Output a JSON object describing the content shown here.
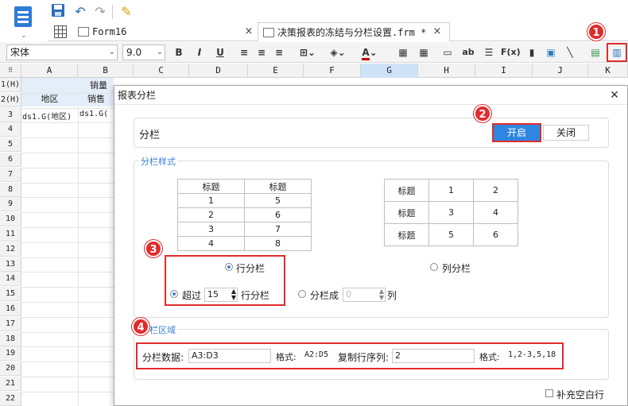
{
  "toolbar": {
    "tabs": [
      {
        "label": "Form16",
        "active": false
      },
      {
        "label": "决策报表的冻结与分栏设置.frm *",
        "active": true
      }
    ]
  },
  "format": {
    "font_name": "宋体",
    "font_size": "9.0",
    "bold": "B",
    "italic": "I",
    "underline": "U"
  },
  "sheet": {
    "columns": [
      "A",
      "B",
      "C",
      "D",
      "E",
      "F",
      "G",
      "H",
      "I",
      "J",
      "K"
    ],
    "rows": [
      "1(H)",
      "2(H)",
      "3",
      "4",
      "5",
      "6",
      "7",
      "8",
      "9",
      "10",
      "11",
      "12",
      "13",
      "14",
      "15",
      "16",
      "17",
      "18",
      "19",
      "20",
      "21",
      "22"
    ],
    "cell_c1": "销量",
    "cell_a2": "地区",
    "cell_b2": "销售",
    "cell_a3": "ds1.G(地区)",
    "cell_b3": "ds1.G("
  },
  "dialog": {
    "title": "报表分栏",
    "section_label": "分栏",
    "open_label": "开启",
    "close_label": "关闭",
    "style_group": "分栏样式",
    "left_preview": [
      [
        "标题",
        "标题"
      ],
      [
        "1",
        "5"
      ],
      [
        "2",
        "6"
      ],
      [
        "3",
        "7"
      ],
      [
        "4",
        "8"
      ]
    ],
    "right_preview": [
      [
        "标题",
        "1",
        "2"
      ],
      [
        "标题",
        "3",
        "4"
      ],
      [
        "标题",
        "5",
        "6"
      ]
    ],
    "row_mode_label": "行分栏",
    "col_mode_label": "列分栏",
    "exceed_label": "超过",
    "exceed_value": "15",
    "exceed_suffix": "行分栏",
    "split_into_label": "分栏成",
    "split_into_value": "0",
    "split_into_suffix": "列",
    "area_group": "分栏区域",
    "data_label": "分栏数据:",
    "data_value": "A3:D3",
    "format1_label": "格式:",
    "format1_value": "A2:D5",
    "copy_label": "复制行序列:",
    "copy_value": "2",
    "format2_label": "格式:",
    "format2_value": "1,2-3,5,18",
    "fill_label": "补充空白行"
  },
  "badges": [
    "1",
    "2",
    "3",
    "4"
  ],
  "colors": {
    "accent": "#2f86e0",
    "highlight": "#e02c2c",
    "section": "#3a7fd5"
  }
}
